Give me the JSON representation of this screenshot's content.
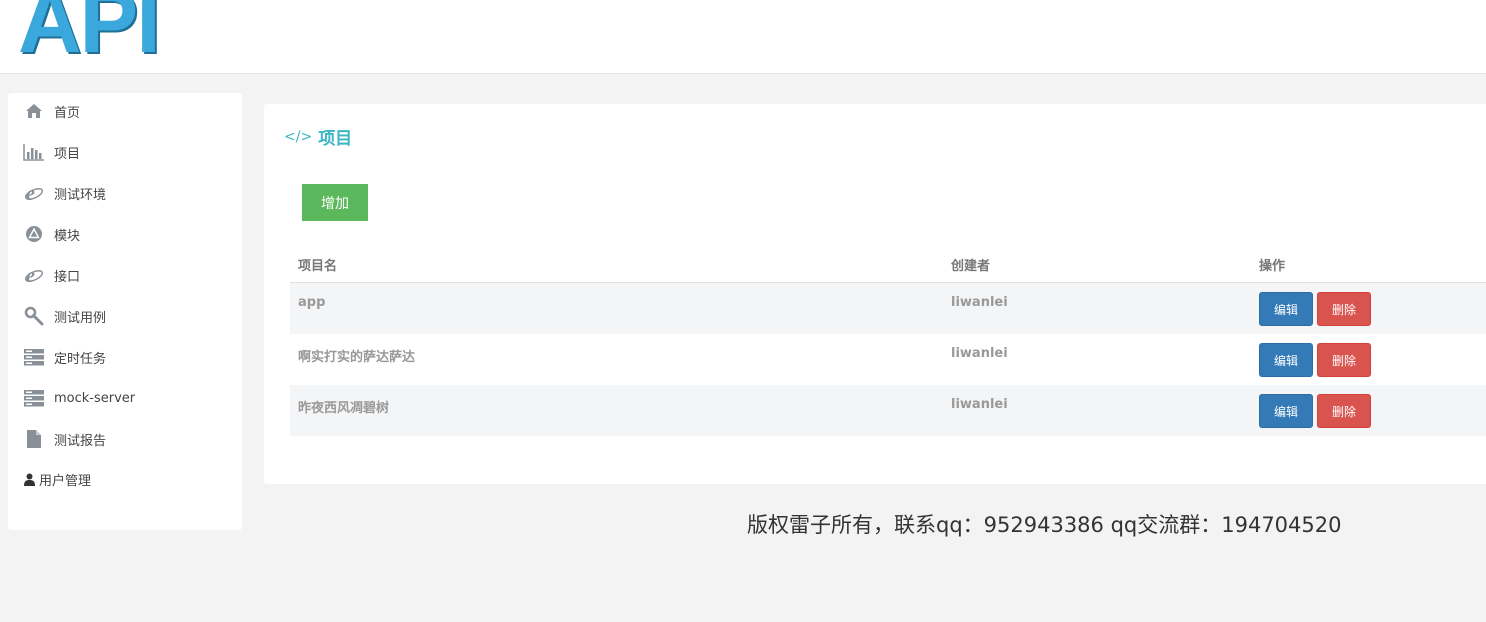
{
  "header": {
    "logo_text": "API"
  },
  "sidebar": {
    "items": [
      {
        "label": "首页",
        "icon": "home-icon"
      },
      {
        "label": "项目",
        "icon": "bar-chart-icon"
      },
      {
        "label": "测试环境",
        "icon": "ie-browser-icon"
      },
      {
        "label": "模块",
        "icon": "circle-triangle-icon"
      },
      {
        "label": "接口",
        "icon": "ie-browser-icon"
      },
      {
        "label": "测试用例",
        "icon": "wrench-icon"
      },
      {
        "label": "定时任务",
        "icon": "server-icon"
      },
      {
        "label": "mock-server",
        "icon": "server-icon"
      },
      {
        "label": "测试报告",
        "icon": "file-icon"
      },
      {
        "label": "用户管理",
        "icon": "user-icon"
      }
    ]
  },
  "main": {
    "title": "项目",
    "title_icon": "</>",
    "add_label": "增加",
    "table": {
      "headers": [
        "项目名",
        "创建者",
        "操作"
      ],
      "edit_label": "编辑",
      "delete_label": "删除",
      "rows": [
        {
          "name": "app",
          "creator": "liwanlei"
        },
        {
          "name": "啊实打实的萨达萨达",
          "creator": "liwanlei"
        },
        {
          "name": "昨夜西风凋碧树",
          "creator": "liwanlei"
        }
      ]
    }
  },
  "footer": {
    "text": "版权雷子所有，联系qq：952943386 qq交流群：194704520"
  },
  "colors": {
    "logo": "#3aa8dc",
    "title": "#3ab6c4",
    "add_button": "#5cb85c",
    "edit_button": "#337ab7",
    "delete_button": "#d9534f"
  }
}
